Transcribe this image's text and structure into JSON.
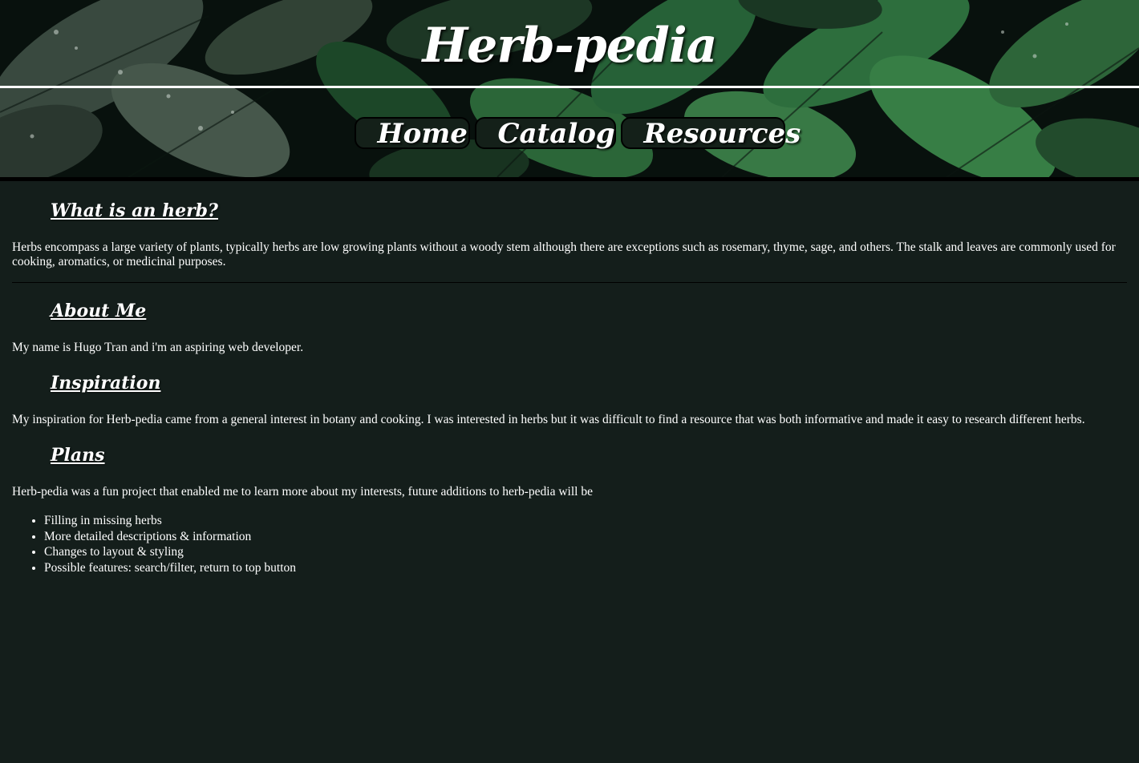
{
  "site": {
    "title": "Herb-pedia"
  },
  "nav": {
    "items": [
      {
        "label": "Home"
      },
      {
        "label": "Catalog"
      },
      {
        "label": "Resources"
      }
    ]
  },
  "sections": {
    "what": {
      "heading": "What is an herb?",
      "text": "Herbs encompass a large variety of plants, typically herbs are low growing plants without a woody stem although there are exceptions such as rosemary, thyme, sage, and others. The stalk and leaves are commonly used for cooking, aromatics, or medicinal purposes."
    },
    "about": {
      "heading": "About Me",
      "text": "My name is Hugo Tran and i'm an aspiring web developer."
    },
    "inspiration": {
      "heading": "Inspiration",
      "text": "My inspiration for Herb-pedia came from a general interest in botany and cooking. I was interested in herbs but it was difficult to find a resource that was both informative and made it easy to research different herbs."
    },
    "plans": {
      "heading": "Plans",
      "text": "Herb-pedia was a fun project that enabled me to learn more about my interests, future additions to herb-pedia will be",
      "items": [
        "Filling in missing herbs",
        "More detailed descriptions & information",
        "Changes to layout & styling",
        "Possible features: search/filter, return to top button"
      ]
    }
  },
  "colors": {
    "page_background": "#141e1b",
    "header_background": "#0a1410",
    "nav_button_background": "#142019",
    "text": "#ffffff"
  }
}
